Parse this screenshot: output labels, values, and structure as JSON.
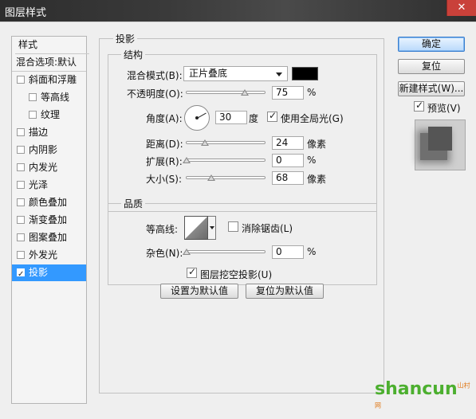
{
  "window": {
    "title": "图层样式",
    "close_symbol": "✕"
  },
  "style_list": {
    "header": "样式",
    "blend_options": "混合选项:默认",
    "items": [
      {
        "label": "斜面和浮雕",
        "checked": false
      },
      {
        "label": "等高线",
        "checked": false
      },
      {
        "label": "纹理",
        "checked": false
      },
      {
        "label": "描边",
        "checked": false
      },
      {
        "label": "内阴影",
        "checked": false
      },
      {
        "label": "内发光",
        "checked": false
      },
      {
        "label": "光泽",
        "checked": false
      },
      {
        "label": "颜色叠加",
        "checked": false
      },
      {
        "label": "渐变叠加",
        "checked": false
      },
      {
        "label": "图案叠加",
        "checked": false
      },
      {
        "label": "外发光",
        "checked": false
      },
      {
        "label": "投影",
        "checked": true,
        "selected": true
      }
    ]
  },
  "drop_shadow": {
    "title": "投影",
    "structure": {
      "title": "结构",
      "blend_mode_label": "混合模式(B):",
      "blend_mode_value": "正片叠底",
      "blend_color": "#000000",
      "opacity_label": "不透明度(O):",
      "opacity_value": "75",
      "opacity_unit": "%",
      "angle_label": "角度(A):",
      "angle_value": "30",
      "angle_unit": "度",
      "global_light_label": "使用全局光(G)",
      "global_light_checked": true,
      "distance_label": "距离(D):",
      "distance_value": "24",
      "distance_unit": "像素",
      "spread_label": "扩展(R):",
      "spread_value": "0",
      "spread_unit": "%",
      "size_label": "大小(S):",
      "size_value": "68",
      "size_unit": "像素"
    },
    "quality": {
      "title": "品质",
      "contour_label": "等高线:",
      "anti_aliased_label": "消除锯齿(L)",
      "anti_aliased_checked": false,
      "noise_label": "杂色(N):",
      "noise_value": "0",
      "noise_unit": "%"
    },
    "knockout_label": "图层挖空投影(U)",
    "knockout_checked": true,
    "make_default_label": "设置为默认值",
    "reset_default_label": "复位为默认值"
  },
  "buttons": {
    "ok": "确定",
    "reset": "复位",
    "new_style": "新建样式(W)...",
    "preview_label": "预览(V)",
    "preview_checked": true
  },
  "watermark": {
    "text": "shancun",
    "small": "山村网"
  }
}
